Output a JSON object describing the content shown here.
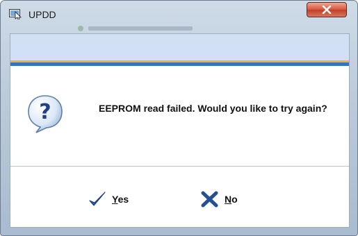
{
  "window": {
    "title": "UPDD",
    "close_tooltip": "Close"
  },
  "dialog": {
    "message": "EEPROM read failed. Would you like to try again?",
    "icon": "question-icon"
  },
  "buttons": {
    "yes": {
      "accel": "Y",
      "rest": "es",
      "icon": "check-icon"
    },
    "no": {
      "accel": "N",
      "rest": "o",
      "icon": "x-icon"
    }
  },
  "colors": {
    "banner": "#d2e0f6",
    "accent": "#f0b430",
    "stripe": "#3274c6",
    "close_button": "#c13f2a"
  }
}
